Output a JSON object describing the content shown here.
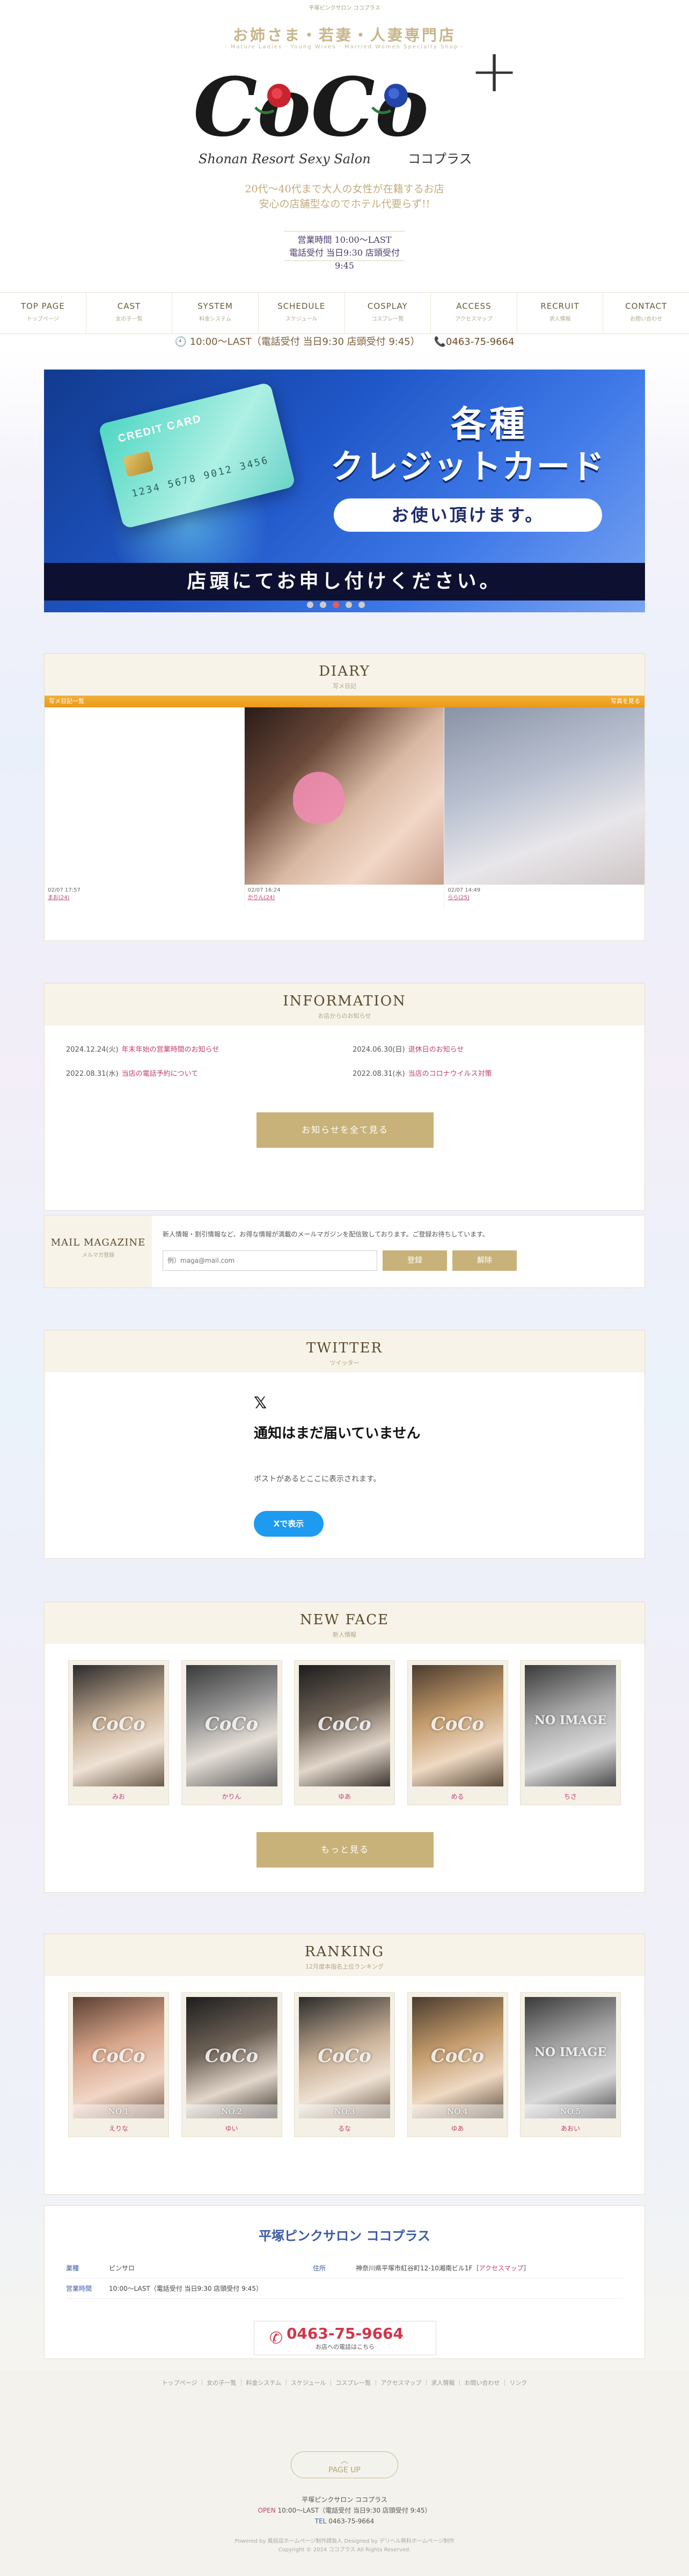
{
  "header": {
    "top_text": "平塚ピンクサロン ココプラス",
    "tagline": "お姉さま・若妻・人妻専門店",
    "tagline_sub": "- Mature Ladies · Young Wives · Married Women Specialty Shop -",
    "logo_text": "CoCo",
    "logo_plus": "+",
    "logo_sub": "Shonan Resort Sexy Salon",
    "logo_jp": "ココプラス",
    "catch_1": "20代～40代まで大人の女性が在籍するお店",
    "catch_2": "安心の店舗型なのでホテル代要らず!!",
    "hours_1": "営業時間 10:00～LAST",
    "hours_2": "電話受付 当日9:30 店頭受付 9:45"
  },
  "nav": [
    {
      "en": "TOP PAGE",
      "jp": "トップページ"
    },
    {
      "en": "CAST",
      "jp": "女の子一覧"
    },
    {
      "en": "SYSTEM",
      "jp": "料金システム"
    },
    {
      "en": "SCHEDULE",
      "jp": "スケジュール"
    },
    {
      "en": "COSPLAY",
      "jp": "コスプレ一覧"
    },
    {
      "en": "ACCESS",
      "jp": "アクセスマップ"
    },
    {
      "en": "RECRUIT",
      "jp": "求人情報"
    },
    {
      "en": "CONTACT",
      "jp": "お問い合わせ"
    }
  ],
  "infobar": {
    "hours": "10:00～LAST（電話受付 当日9:30 店頭受付 9:45）",
    "tel": "0463-75-9664"
  },
  "banner": {
    "card_label": "CREDIT CARD",
    "card_number": "1234 5678 9012 3456",
    "line1": "各種",
    "line2": "クレジットカード",
    "pill": "お使い頂けます。",
    "strip": "店頭にてお申し付けください。"
  },
  "diary": {
    "title": "DIARY",
    "sub": "写メ日記",
    "bar_label": "写メ日記一覧",
    "bar_more": "写真を見る",
    "entries": [
      {
        "date": "02/07 17:57",
        "name": "まお(24)"
      },
      {
        "date": "02/07 16:24",
        "name": "かりん(24)"
      },
      {
        "date": "02/07 14:49",
        "name": "らら(25)"
      }
    ]
  },
  "information": {
    "title": "INFORMATION",
    "sub": "お店からのお知らせ",
    "items": [
      {
        "date": "2024.12.24(火)",
        "text": "年末年始の営業時間のお知らせ"
      },
      {
        "date": "2024.06.30(日)",
        "text": "退休日のお知らせ"
      },
      {
        "date": "2022.08.31(水)",
        "text": "当店の電話予約について"
      },
      {
        "date": "2022.08.31(水)",
        "text": "当店のコロナウイルス対策"
      }
    ],
    "more_button": "お知らせを全て見る"
  },
  "mail": {
    "title": "MAIL MAGAZINE",
    "sub": "メルマガ登録",
    "desc": "新人情報・割引情報など、お得な情報が満載のメールマガジンを配信致しております。ご登録お待ちしています。",
    "placeholder": "例）maga@mail.com",
    "register": "登録",
    "unregister": "解除"
  },
  "twitter": {
    "title": "TWITTER",
    "sub": "ツイッター",
    "x_logo": "𝕏",
    "empty_title": "通知はまだ届いていません",
    "empty_sub": "ポストがあるとここに表示されます。",
    "button": "Xで表示"
  },
  "newface": {
    "title": "NEW FACE",
    "sub": "新人情報",
    "watermark": "CoCo",
    "noimage": "NO IMAGE",
    "casts": [
      "みお",
      "かりん",
      "ゆあ",
      "める",
      "ちさ"
    ],
    "more_button": "もっと見る"
  },
  "ranking": {
    "title": "RANKING",
    "sub": "12月度本指名上位ランキング",
    "watermark": "CoCo",
    "noimage": "NO IMAGE",
    "entries": [
      {
        "rank": "NO.1",
        "name": "えりな"
      },
      {
        "rank": "NO.2",
        "name": "ゆい"
      },
      {
        "rank": "NO.3",
        "name": "るな"
      },
      {
        "rank": "NO.4",
        "name": "ゆあ"
      },
      {
        "rank": "NO.5",
        "name": "あおい"
      }
    ]
  },
  "shop": {
    "name": "平塚ピンクサロン ココプラス",
    "type_label": "業種",
    "type_value": "ピンサロ",
    "address_label": "住所",
    "address_value": "神奈川県平塚市紅谷町12-10湘南ビル1F",
    "access_link": "アクセスマップ",
    "hours_label": "営業時間",
    "hours_value": "10:00～LAST（電話受付 当日9:30 店頭受付 9:45）",
    "tel": "0463-75-9664",
    "tel_sub": "お店への電話はこちら"
  },
  "footer": {
    "links": "トップページ ｜ 女の子一覧 ｜ 料金システム ｜ スケジュール ｜ コスプレ一覧 ｜ アクセスマップ ｜ 求人情報 ｜ お問い合わせ ｜ リンク",
    "pageup_arrow": "︿",
    "pageup": "PAGE UP",
    "shop_name": "平塚ピンクサロン ココプラス",
    "open_label": "OPEN",
    "open_value": "10:00～LAST（電話受付 当日9:30 店頭受付 9:45）",
    "tel_label": "TEL",
    "tel_value": "0463-75-9664",
    "powered": "Powered by 風俗店ホームページ制作請負人  Designed by デリヘル無料ホームページ制作",
    "copyright": "Copyright © 2024 ココプラス All Rights Reserved."
  }
}
